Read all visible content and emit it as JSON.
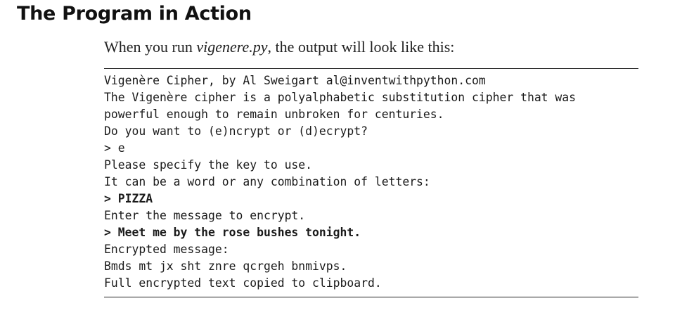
{
  "section": {
    "title": "The Program in Action"
  },
  "intro": {
    "before": "When you run ",
    "filename": "vigenere.py",
    "after": ", the output will look like this:"
  },
  "listing": {
    "lines": [
      {
        "text": "Vigenère Cipher, by Al Sweigart al@inventwithpython.com",
        "user_input": false
      },
      {
        "text": "The Vigenère cipher is a polyalphabetic substitution cipher that was",
        "user_input": false
      },
      {
        "text": "powerful enough to remain unbroken for centuries.",
        "user_input": false
      },
      {
        "text": "Do you want to (e)ncrypt or (d)ecrypt?",
        "user_input": false
      },
      {
        "text": "> e",
        "user_input": false
      },
      {
        "text": "Please specify the key to use.",
        "user_input": false
      },
      {
        "text": "It can be a word or any combination of letters:",
        "user_input": false
      },
      {
        "text": "> PIZZA",
        "user_input": true
      },
      {
        "text": "Enter the message to encrypt.",
        "user_input": false
      },
      {
        "text": "> Meet me by the rose bushes tonight.",
        "user_input": true
      },
      {
        "text": "Encrypted message:",
        "user_input": false
      },
      {
        "text": "Bmds mt jx sht znre qcrgeh bnmivps.",
        "user_input": false
      },
      {
        "text": "Full encrypted text copied to clipboard.",
        "user_input": false
      }
    ]
  }
}
